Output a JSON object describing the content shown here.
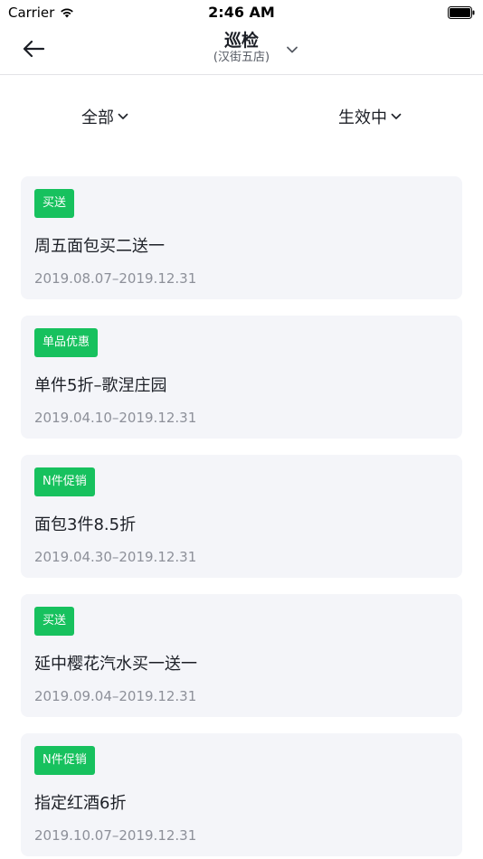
{
  "status_bar": {
    "carrier": "Carrier",
    "time": "2:46 AM"
  },
  "nav": {
    "title": "巡检",
    "subtitle": "(汉街五店)",
    "icons": {
      "back": "arrow-left-icon",
      "dropdown": "chevron-down-icon"
    }
  },
  "filters": {
    "all_label": "全部",
    "status_label": "生效中"
  },
  "promotions": [
    {
      "tag": "买送",
      "name": "周五面包买二送一",
      "dates": "2019.08.07–2019.12.31"
    },
    {
      "tag": "单品优惠",
      "name": "单件5折–歌涅庄园",
      "dates": "2019.04.10–2019.12.31"
    },
    {
      "tag": "N件促销",
      "name": "面包3件8.5折",
      "dates": "2019.04.30–2019.12.31"
    },
    {
      "tag": "买送",
      "name": "延中樱花汽水买一送一",
      "dates": "2019.09.04–2019.12.31"
    },
    {
      "tag": "N件促销",
      "name": "指定红酒6折",
      "dates": "2019.10.07–2019.12.31"
    }
  ],
  "colors": {
    "tag_green": "#17c15e",
    "card_bg": "#f4f5f9",
    "date_gray": "#8d9099"
  }
}
